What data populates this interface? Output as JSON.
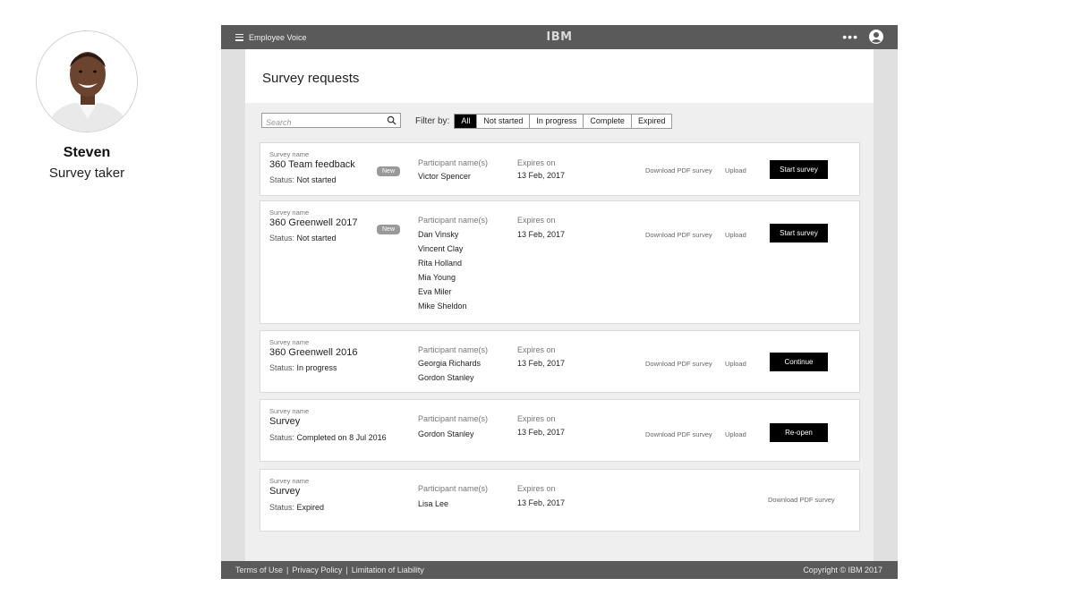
{
  "persona": {
    "name": "Steven",
    "role": "Survey taker"
  },
  "header": {
    "app_name": "Employee Voice",
    "brand": "IBM",
    "more_label": "•••"
  },
  "page": {
    "title": "Survey requests"
  },
  "search": {
    "placeholder": "Search",
    "value": ""
  },
  "filter": {
    "label": "Filter by:",
    "options": [
      "All",
      "Not started",
      "In progress",
      "Complete",
      "Expired"
    ],
    "selected": "All"
  },
  "labels": {
    "survey_name": "Survey name",
    "status": "Status:",
    "participants": "Participant name(s)",
    "expires": "Expires on",
    "download": "Download PDF survey",
    "upload": "Upload"
  },
  "surveys": [
    {
      "name": "360 Team feedback",
      "badge": "New",
      "status": "Not started",
      "participants": [
        "Victor Spencer"
      ],
      "expires": "13 Feb, 2017",
      "action": "Start survey"
    },
    {
      "name": "360 Greenwell 2017",
      "badge": "New",
      "status": "Not started",
      "participants": [
        "Dan Vinsky",
        "Vincent Clay",
        "Rita Holland",
        "Mia Young",
        "Eva Miler",
        "Mike Sheldon"
      ],
      "expires": "13 Feb, 2017",
      "action": "Start survey"
    },
    {
      "name": "360 Greenwell  2016",
      "status": "In progress",
      "participants": [
        "Georgia Richards",
        "Gordon Stanley"
      ],
      "expires": "13 Feb, 2017",
      "action": "Continue"
    },
    {
      "name": "Survey",
      "status": "Completed on 8 Jul 2016",
      "participants": [
        "Gordon Stanley"
      ],
      "expires": "13 Feb, 2017",
      "action": "Re-open"
    },
    {
      "name": "Survey",
      "status": "Expired",
      "participants": [
        "Lisa Lee"
      ],
      "expires": "13 Feb, 2017"
    }
  ],
  "footer": {
    "links": [
      "Terms of Use",
      "Privacy Policy",
      "Limitation of Liability"
    ],
    "copyright": "Copyright © IBM 2017"
  }
}
